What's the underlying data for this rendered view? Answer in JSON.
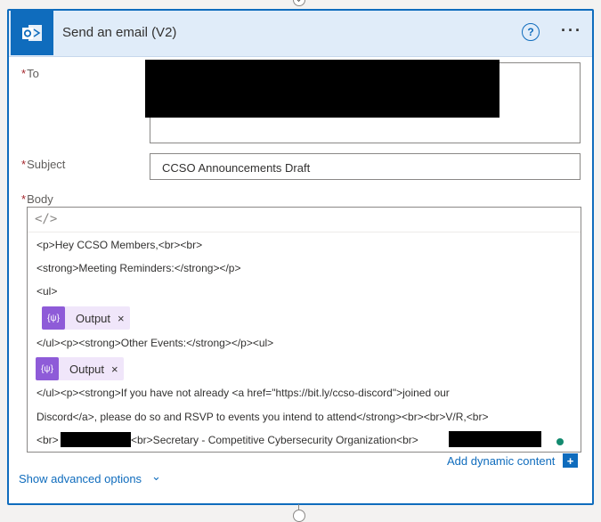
{
  "header": {
    "app_icon": "outlook-icon",
    "title": "Send an email (V2)",
    "help_icon": "help-icon",
    "more_icon": "more-icon",
    "help_glyph": "?",
    "more_glyph": "···"
  },
  "fields": {
    "required_mark": "*",
    "to_label": "To",
    "subject_label": "Subject",
    "subject_value": "CCSO Announcements Draft",
    "body_label": "Body"
  },
  "body": {
    "code_view_icon": "code-icon",
    "code_glyph": "</>",
    "lines": [
      "<p>Hey CCSO Members,<br><br>",
      "<strong>Meeting Reminders:</strong></p>",
      "<ul>",
      "</ul><p><strong>Other Events:</strong></p><ul>",
      "</ul><p><strong>If you have not already <a href=\"https://bit.ly/ccso-discord\">joined our",
      "Discord</a>, please do so and RSVP to events you intend to attend</strong><br><br>V/R,<br>",
      "<br>",
      "<br>Secretary - Competitive Cybersecurity Organization<br>"
    ],
    "tokens": [
      {
        "label": "Output",
        "icon_glyph": "{ψ}",
        "remove": "×"
      },
      {
        "label": "Output",
        "icon_glyph": "{ψ}",
        "remove": "×"
      }
    ]
  },
  "footer": {
    "add_dynamic": "Add dynamic content",
    "add_glyph": "+",
    "show_advanced": "Show advanced options",
    "chevron": "⌄"
  }
}
